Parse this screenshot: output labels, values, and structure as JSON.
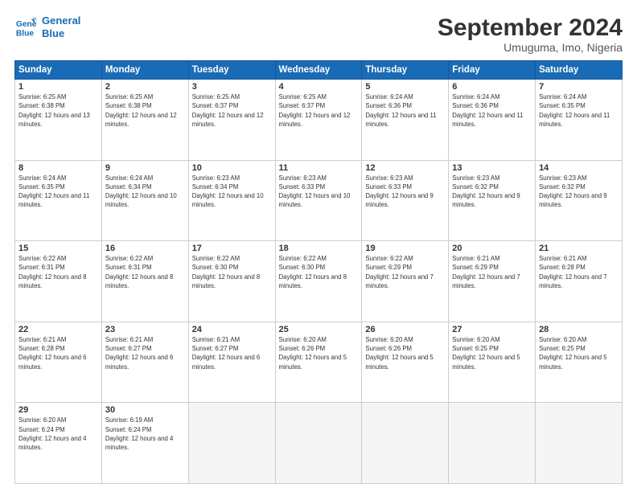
{
  "header": {
    "logo_line1": "General",
    "logo_line2": "Blue",
    "title": "September 2024",
    "subtitle": "Umuguma, Imo, Nigeria"
  },
  "days_of_week": [
    "Sunday",
    "Monday",
    "Tuesday",
    "Wednesday",
    "Thursday",
    "Friday",
    "Saturday"
  ],
  "weeks": [
    [
      {
        "num": "1",
        "rise": "6:25 AM",
        "set": "6:38 PM",
        "daylight": "12 hours and 13 minutes."
      },
      {
        "num": "2",
        "rise": "6:25 AM",
        "set": "6:38 PM",
        "daylight": "12 hours and 12 minutes."
      },
      {
        "num": "3",
        "rise": "6:25 AM",
        "set": "6:37 PM",
        "daylight": "12 hours and 12 minutes."
      },
      {
        "num": "4",
        "rise": "6:25 AM",
        "set": "6:37 PM",
        "daylight": "12 hours and 12 minutes."
      },
      {
        "num": "5",
        "rise": "6:24 AM",
        "set": "6:36 PM",
        "daylight": "12 hours and 11 minutes."
      },
      {
        "num": "6",
        "rise": "6:24 AM",
        "set": "6:36 PM",
        "daylight": "12 hours and 11 minutes."
      },
      {
        "num": "7",
        "rise": "6:24 AM",
        "set": "6:35 PM",
        "daylight": "12 hours and 11 minutes."
      }
    ],
    [
      {
        "num": "8",
        "rise": "6:24 AM",
        "set": "6:35 PM",
        "daylight": "12 hours and 11 minutes."
      },
      {
        "num": "9",
        "rise": "6:24 AM",
        "set": "6:34 PM",
        "daylight": "12 hours and 10 minutes."
      },
      {
        "num": "10",
        "rise": "6:23 AM",
        "set": "6:34 PM",
        "daylight": "12 hours and 10 minutes."
      },
      {
        "num": "11",
        "rise": "6:23 AM",
        "set": "6:33 PM",
        "daylight": "12 hours and 10 minutes."
      },
      {
        "num": "12",
        "rise": "6:23 AM",
        "set": "6:33 PM",
        "daylight": "12 hours and 9 minutes."
      },
      {
        "num": "13",
        "rise": "6:23 AM",
        "set": "6:32 PM",
        "daylight": "12 hours and 9 minutes."
      },
      {
        "num": "14",
        "rise": "6:23 AM",
        "set": "6:32 PM",
        "daylight": "12 hours and 9 minutes."
      }
    ],
    [
      {
        "num": "15",
        "rise": "6:22 AM",
        "set": "6:31 PM",
        "daylight": "12 hours and 8 minutes."
      },
      {
        "num": "16",
        "rise": "6:22 AM",
        "set": "6:31 PM",
        "daylight": "12 hours and 8 minutes."
      },
      {
        "num": "17",
        "rise": "6:22 AM",
        "set": "6:30 PM",
        "daylight": "12 hours and 8 minutes."
      },
      {
        "num": "18",
        "rise": "6:22 AM",
        "set": "6:30 PM",
        "daylight": "12 hours and 8 minutes."
      },
      {
        "num": "19",
        "rise": "6:22 AM",
        "set": "6:29 PM",
        "daylight": "12 hours and 7 minutes."
      },
      {
        "num": "20",
        "rise": "6:21 AM",
        "set": "6:29 PM",
        "daylight": "12 hours and 7 minutes."
      },
      {
        "num": "21",
        "rise": "6:21 AM",
        "set": "6:28 PM",
        "daylight": "12 hours and 7 minutes."
      }
    ],
    [
      {
        "num": "22",
        "rise": "6:21 AM",
        "set": "6:28 PM",
        "daylight": "12 hours and 6 minutes."
      },
      {
        "num": "23",
        "rise": "6:21 AM",
        "set": "6:27 PM",
        "daylight": "12 hours and 6 minutes."
      },
      {
        "num": "24",
        "rise": "6:21 AM",
        "set": "6:27 PM",
        "daylight": "12 hours and 6 minutes."
      },
      {
        "num": "25",
        "rise": "6:20 AM",
        "set": "6:26 PM",
        "daylight": "12 hours and 5 minutes."
      },
      {
        "num": "26",
        "rise": "6:20 AM",
        "set": "6:26 PM",
        "daylight": "12 hours and 5 minutes."
      },
      {
        "num": "27",
        "rise": "6:20 AM",
        "set": "6:25 PM",
        "daylight": "12 hours and 5 minutes."
      },
      {
        "num": "28",
        "rise": "6:20 AM",
        "set": "6:25 PM",
        "daylight": "12 hours and 5 minutes."
      }
    ],
    [
      {
        "num": "29",
        "rise": "6:20 AM",
        "set": "6:24 PM",
        "daylight": "12 hours and 4 minutes."
      },
      {
        "num": "30",
        "rise": "6:19 AM",
        "set": "6:24 PM",
        "daylight": "12 hours and 4 minutes."
      },
      null,
      null,
      null,
      null,
      null
    ]
  ]
}
